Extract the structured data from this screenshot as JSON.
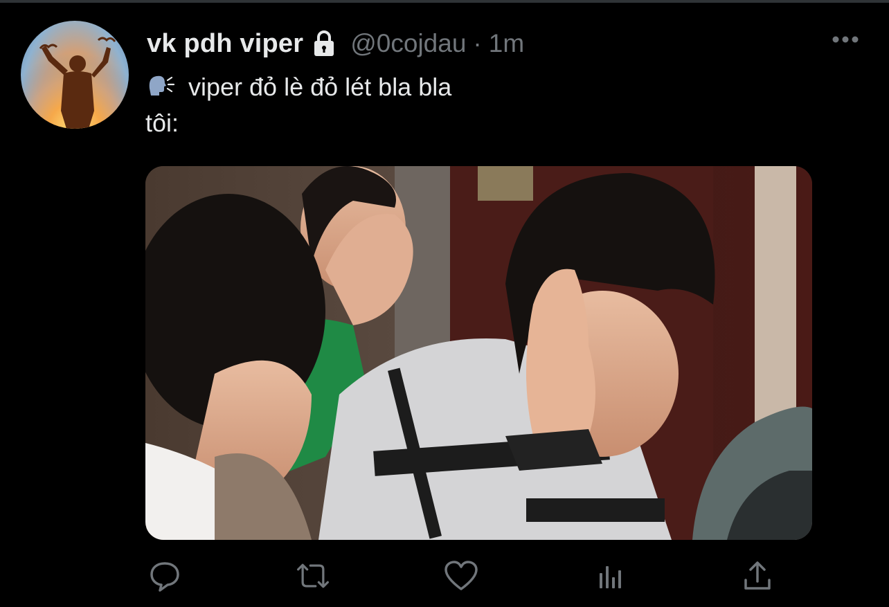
{
  "tweet": {
    "display_name": "vk pdh viper",
    "handle": "@0cojdau",
    "separator": "·",
    "time": "1m",
    "text_line1": "viper đỏ lè đỏ lét bla bla",
    "text_line2": "tôi:"
  },
  "icons": {
    "lock": "lock-icon",
    "more": "more-options-icon",
    "speaking": "speaking-head-icon",
    "reply": "reply-icon",
    "retweet": "retweet-icon",
    "like": "like-heart-icon",
    "analytics": "analytics-icon",
    "share": "share-icon"
  },
  "colors": {
    "background": "#000000",
    "primary_text": "#e7e9ea",
    "secondary_text": "#71767b"
  }
}
